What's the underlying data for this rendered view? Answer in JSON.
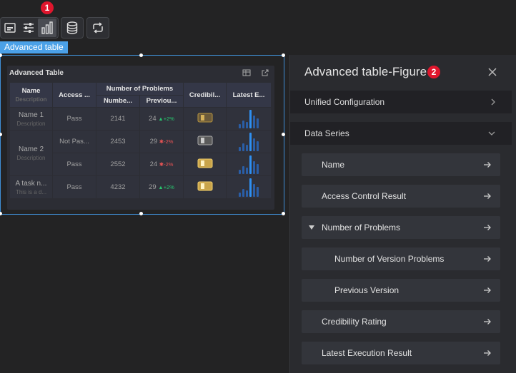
{
  "toolbar": {
    "buttons": [
      "image-icon",
      "sliders-icon",
      "bar-chart-icon",
      "database-icon",
      "refresh-icon"
    ],
    "badge1": "1"
  },
  "selection": {
    "tag": "Advanced table"
  },
  "table": {
    "title": "Advanced Table",
    "headers": {
      "name": "Name",
      "name_desc": "Description",
      "access": "Access ...",
      "problems_group": "Number of Problems",
      "number": "Numbe...",
      "previous": "Previou...",
      "credibility": "Credibil...",
      "latest": "Latest E..."
    },
    "rows": [
      {
        "name": "Name 1",
        "desc": "Description",
        "access": "Pass",
        "number": "2141",
        "prev": "24",
        "trend": "+2%",
        "trend_dir": "up"
      },
      {
        "name": "Name 2",
        "desc": "Description",
        "access": "Not Pas...",
        "number": "2453",
        "prev": "29",
        "trend": "-2%",
        "trend_dir": "down"
      },
      {
        "access": "Pass",
        "number": "2552",
        "prev": "24",
        "trend": "-2%",
        "trend_dir": "down"
      },
      {
        "name": "A task n...",
        "desc": "This is a d...",
        "access": "Pass",
        "number": "4232",
        "prev": "29",
        "trend": "+2%",
        "trend_dir": "up"
      }
    ]
  },
  "panel": {
    "title": "Advanced table-Figure",
    "badge2": "2",
    "sections": {
      "unified": "Unified Configuration",
      "series": "Data Series"
    },
    "items": {
      "name": "Name",
      "access": "Access Control Result",
      "problems": "Number of Problems",
      "version": "Number of Version Problems",
      "previous": "Previous Version",
      "credibility": "Credibility Rating",
      "latest": "Latest Execution Result"
    }
  },
  "colors": {
    "accent": "#3f8fd6",
    "badge": "#e0162d",
    "up": "#28c76f",
    "down": "#ea5455"
  }
}
